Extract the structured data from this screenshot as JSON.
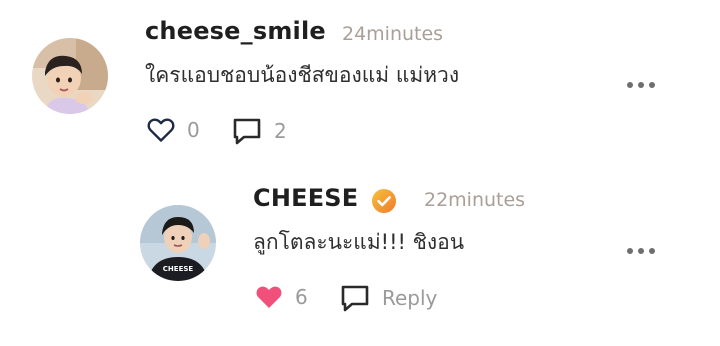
{
  "comments": [
    {
      "username": "cheese_smile",
      "time": "24minutes",
      "text": "ใครแอบชอบน้องชีสของแม่ แม่หวง",
      "like_count": "0",
      "reply_count": "2",
      "liked": false
    }
  ],
  "reply": {
    "username": "CHEESE",
    "verified": true,
    "time": "22minutes",
    "text": "ลูกโตละนะแม่!!! ชิงอน",
    "like_count": "6",
    "reply_label": "Reply",
    "liked": true,
    "shirt_text": "CHEESE"
  },
  "colors": {
    "like_active": "#f0507a",
    "icon": "#1f2a44",
    "muted": "#a99f98",
    "verified_gradient": [
      "#f7c23c",
      "#f07a2a"
    ]
  },
  "icons": [
    "heart-outline-icon",
    "comment-icon",
    "heart-filled-icon",
    "verified-badge-icon",
    "more-options-icon"
  ]
}
